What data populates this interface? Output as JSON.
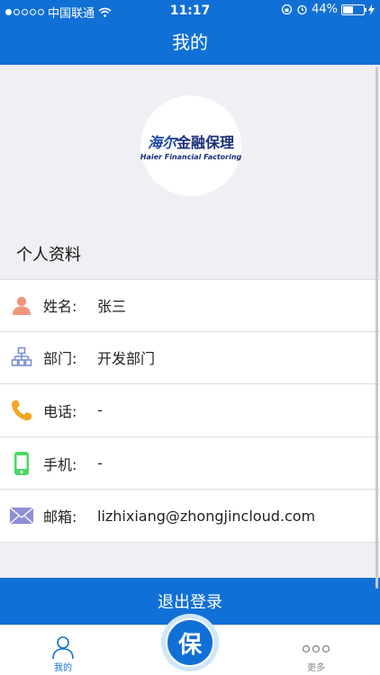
{
  "status_bar": {
    "carrier": "中国联通",
    "time": "11:17",
    "battery_percent": "44%",
    "battery_level": 0.44,
    "icons": [
      "signal-dots",
      "wifi",
      "rotation-lock",
      "alarm",
      "battery",
      "charging-bolt"
    ]
  },
  "navbar": {
    "title": "我的"
  },
  "logo": {
    "main_left": "海尔",
    "main_right": "金融保理",
    "subtitle": "Haier Financial Factoring"
  },
  "profile": {
    "section_title": "个人资料",
    "rows": [
      {
        "icon": "person-icon",
        "label": "姓名:",
        "value": "张三"
      },
      {
        "icon": "org-chart-icon",
        "label": "部门:",
        "value": "开发部门"
      },
      {
        "icon": "phone-icon",
        "label": "电话:",
        "value": "-"
      },
      {
        "icon": "mobile-icon",
        "label": "手机:",
        "value": "-"
      },
      {
        "icon": "mail-icon",
        "label": "邮箱:",
        "value": "lizhixiang@zhongjincloud.com"
      }
    ]
  },
  "logout_button": "退出登录",
  "tabbar": {
    "tabs": [
      {
        "label": "我的",
        "icon": "person-outline-icon",
        "active": true
      },
      {
        "label": "更多",
        "icon": "more-dots-icon",
        "active": false
      }
    ],
    "center_label": "保"
  },
  "colors": {
    "primary": "#1170d6",
    "background": "#efeff4",
    "person_icon": "#f0957a",
    "org_icon": "#7b8fd6",
    "phone_icon": "#f5a623",
    "mobile_icon": "#4cd964",
    "mail_icon": "#8f8fd6"
  }
}
